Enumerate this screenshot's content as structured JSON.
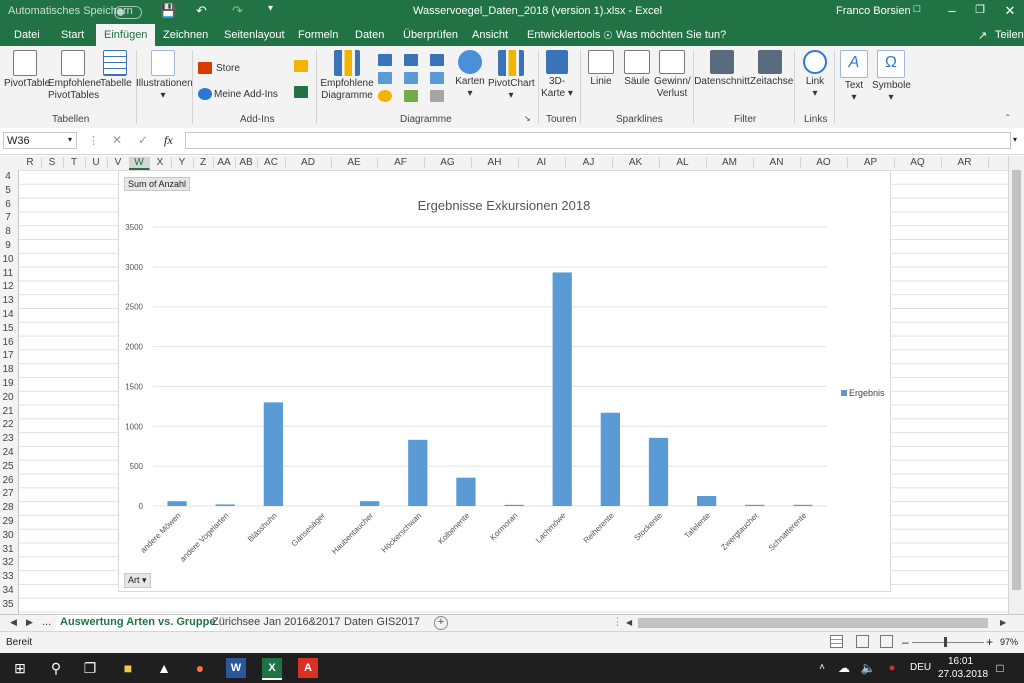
{
  "titlebar": {
    "autosave_label": "Automatisches Speichern",
    "filename": "Wasservoegel_Daten_2018 (version 1).xlsx  -  Excel",
    "user": "Franco Borsien"
  },
  "tabs": [
    "Datei",
    "Start",
    "Einfügen",
    "Zeichnen",
    "Seitenlayout",
    "Formeln",
    "Daten",
    "Überprüfen",
    "Ansicht",
    "Entwicklertools"
  ],
  "active_tab": "Einfügen",
  "tellme": "Was möchten Sie tun?",
  "share": "Teilen",
  "ribbon": {
    "pivottable": "PivotTable",
    "recommended_pivot_1": "Empfohlene",
    "recommended_pivot_2": "PivotTables",
    "table": "Tabelle",
    "illustrations": "Illustrationen",
    "store": "Store",
    "my_addins": "Meine Add-Ins",
    "rec_charts_1": "Empfohlene",
    "rec_charts_2": "Diagramme",
    "maps": "Karten",
    "pivotchart": "PivotChart",
    "map3d_1": "3D-",
    "map3d_2": "Karte",
    "line": "Linie",
    "column": "Säule",
    "winloss_1": "Gewinn/",
    "winloss_2": "Verlust",
    "slicer": "Datenschnitt",
    "timeline": "Zeitachse",
    "link": "Link",
    "text": "Text",
    "symbols": "Symbole",
    "groups": {
      "tables": "Tabellen",
      "addins": "Add-Ins",
      "charts": "Diagramme",
      "tours": "Touren",
      "sparklines": "Sparklines",
      "filter": "Filter",
      "links": "Links"
    }
  },
  "formula_bar": {
    "name_box": "W36",
    "value": ""
  },
  "columns": [
    "R",
    "S",
    "T",
    "U",
    "V",
    "W",
    "X",
    "Y",
    "Z",
    "AA",
    "AB",
    "AC",
    "AD",
    "AE",
    "AF",
    "AG",
    "AH",
    "AI",
    "AJ",
    "AK",
    "AL",
    "AM",
    "AN",
    "AO",
    "AP",
    "AQ",
    "AR"
  ],
  "rows": [
    "4",
    "5",
    "6",
    "7",
    "8",
    "9",
    "10",
    "11",
    "12",
    "13",
    "14",
    "15",
    "16",
    "17",
    "18",
    "19",
    "20",
    "21",
    "22",
    "23",
    "24",
    "25",
    "26",
    "27",
    "28",
    "29",
    "30",
    "31",
    "32",
    "33",
    "34",
    "35"
  ],
  "chart_data": {
    "type": "bar",
    "title": "Ergebnisse Exkursionen 2018",
    "categories": [
      "andere Möwen",
      "andere Vogelarten",
      "Blässhuhn",
      "Gänsesäger",
      "Haubentaucher",
      "Höckerschwan",
      "Kolbenente",
      "Kormoran",
      "Lachmöwe",
      "Reiherente",
      "Stockente",
      "Tafelente",
      "Zwergtaucher",
      "Schnatterente"
    ],
    "series": [
      {
        "name": "Ergebnis",
        "values": [
          60,
          20,
          1300,
          0,
          60,
          830,
          355,
          15,
          2930,
          1170,
          855,
          125,
          15,
          15
        ]
      }
    ],
    "ylim": [
      0,
      3500
    ],
    "yticks": [
      "0",
      "500",
      "1000",
      "1500",
      "2000",
      "2500",
      "3000",
      "3500"
    ],
    "legend": "right",
    "color": "#5b9bd5",
    "field_value": "Sum of Anzahl",
    "field_axis": "Art"
  },
  "sheets": [
    "Auswertung Arten vs. Gruppe",
    "Zürichsee Jan 2016&2017",
    "Daten GIS2017"
  ],
  "active_sheet": "Auswertung Arten vs. Gruppe",
  "sheet_more": "...",
  "status": {
    "ready": "Bereit",
    "zoom": "97%"
  },
  "taskbar": {
    "lang": "DEU",
    "time": "16:01",
    "date": "27.03.2018"
  }
}
